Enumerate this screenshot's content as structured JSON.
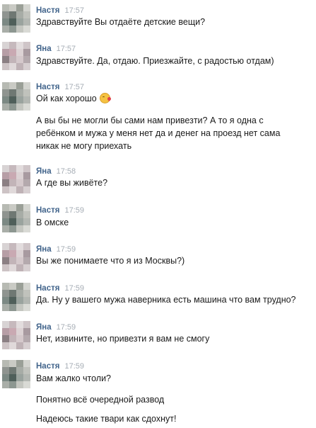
{
  "avatars": {
    "nastya": [
      "#b7bab3",
      "#c9cac4",
      "#9a9f97",
      "#d3d4cf",
      "#8f9490",
      "#6f7873",
      "#a7aca6",
      "#c0c2bc",
      "#7c8984",
      "#4f5f5a",
      "#9aa39e",
      "#b3b7b2",
      "#a9aea8",
      "#8d9791",
      "#c4c6c0",
      "#d9dad5"
    ],
    "yana": [
      "#d8d3d4",
      "#c6b9bd",
      "#e2dcdd",
      "#cfc5c8",
      "#b79ea6",
      "#c9a9b2",
      "#dcd2d4",
      "#a89aa0",
      "#8b7f83",
      "#c2b4b8",
      "#d5c9cc",
      "#b4a9ad",
      "#cdc3c5",
      "#e0d9da",
      "#bfb2b6",
      "#d7cfd1"
    ]
  },
  "messages": [
    {
      "author": "Настя",
      "time": "17:57",
      "lines": [
        "Здравствуйте Вы отдаёте детские вещи?"
      ]
    },
    {
      "author": "Яна",
      "time": "17:57",
      "lines": [
        "Здравствуйте. Да, отдаю. Приезжайте, с радостью отдам)"
      ]
    },
    {
      "author": "Настя",
      "time": "17:57",
      "lines": [
        "Ой как хорошо",
        "А вы бы не могли бы сами нам привезти? А то я одна с",
        "ребёнком и мужа у меня нет да и денег на проезд нет сама",
        "никак не могу приехать"
      ],
      "emoji": "kissing-face-icon"
    },
    {
      "author": "Яна",
      "time": "17:58",
      "lines": [
        "А где вы живёте?"
      ]
    },
    {
      "author": "Настя",
      "time": "17:59",
      "lines": [
        "В омске"
      ]
    },
    {
      "author": "Яна",
      "time": "17:59",
      "lines": [
        "Вы же понимаете что я из Москвы?)"
      ]
    },
    {
      "author": "Настя",
      "time": "17:59",
      "lines": [
        "Да. Ну у вашего мужа наверника есть машина что вам трудно?"
      ]
    },
    {
      "author": "Яна",
      "time": "17:59",
      "lines": [
        "Нет, извините, но привезти я вам не смогу"
      ]
    },
    {
      "author": "Настя",
      "time": "17:59",
      "lines": [
        "Вам жалко чтоли?",
        "Понятно всё очередной развод",
        "Надеюсь такие твари как сдохнут!"
      ]
    }
  ]
}
